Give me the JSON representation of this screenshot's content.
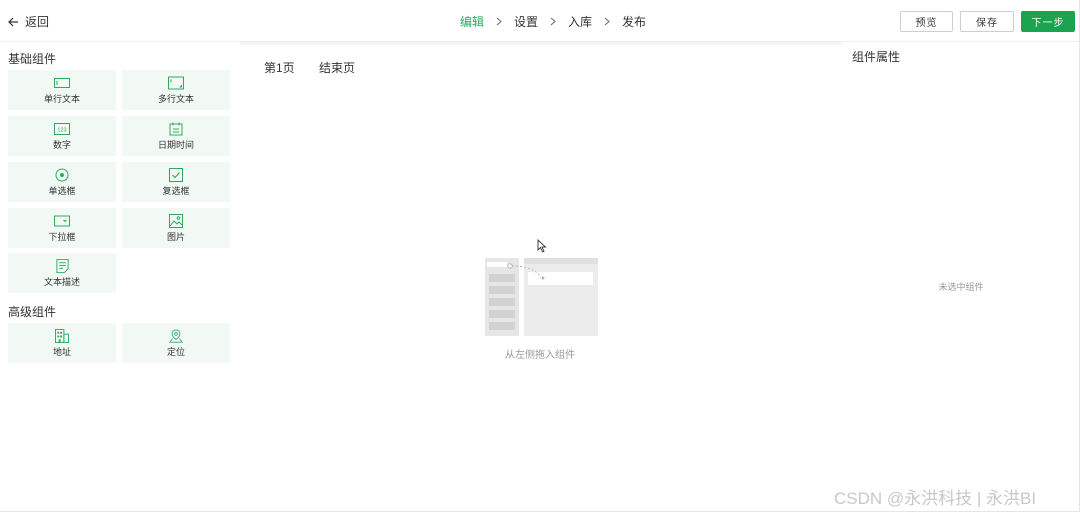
{
  "header": {
    "back_label": "返回",
    "steps": [
      "编辑",
      "设置",
      "入库",
      "发布"
    ],
    "active_step": "编辑",
    "buttons": {
      "preview": "预览",
      "save": "保存",
      "next": "下一步"
    }
  },
  "left_panel": {
    "basic_title": "基础组件",
    "basic_components": [
      {
        "label": "单行文本",
        "icon": "single-line-text-icon"
      },
      {
        "label": "多行文本",
        "icon": "multi-line-text-icon"
      },
      {
        "label": "数字",
        "icon": "number-icon",
        "icon_text": "123"
      },
      {
        "label": "日期时间",
        "icon": "calendar-icon"
      },
      {
        "label": "单选框",
        "icon": "radio-icon"
      },
      {
        "label": "复选框",
        "icon": "checkbox-icon"
      },
      {
        "label": "下拉框",
        "icon": "dropdown-icon"
      },
      {
        "label": "图片",
        "icon": "image-icon"
      },
      {
        "label": "文本描述",
        "icon": "text-description-icon"
      }
    ],
    "advanced_title": "高级组件",
    "advanced_components": [
      {
        "label": "地址",
        "icon": "address-building-icon"
      },
      {
        "label": "定位",
        "icon": "location-pin-icon"
      }
    ]
  },
  "canvas": {
    "tabs": [
      "第1页",
      "结束页"
    ],
    "empty_hint": "从左侧拖入组件"
  },
  "right_panel": {
    "title": "组件属性",
    "empty_text": "未选中组件"
  },
  "watermark": "CSDN @永洪科技 | 永洪BI",
  "colors": {
    "accent": "#1ba350",
    "active_step": "#2eaa5f",
    "tile_bg": "#f2f9f4",
    "icon": "#2eaa5f"
  }
}
